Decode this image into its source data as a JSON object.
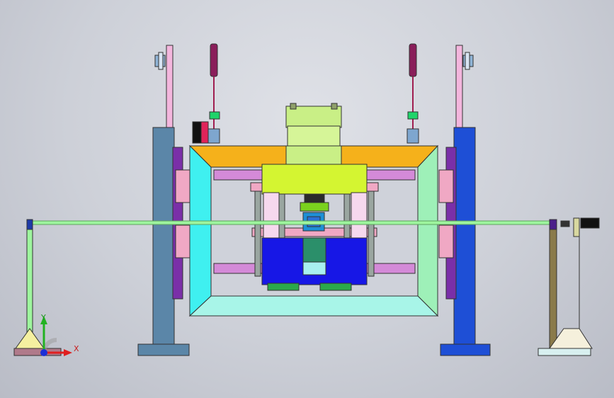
{
  "view": {
    "background_top": "#dfe1e7",
    "background_bottom": "#b9bcc6"
  },
  "triad": {
    "x_label": "X",
    "y_label": "Y",
    "x_color": "#e01f1f",
    "y_color": "#22b222",
    "z_color": "#1b2fd6"
  },
  "colors": {
    "left_post": "#5b86a8",
    "right_post": "#1e4fd6",
    "top_beam": "#f5b11b",
    "frame_left": "#3ff0f0",
    "frame_right": "#9ef0b8",
    "frame_bottom": "#a8f5e8",
    "cylinder": "#c9ef86",
    "press_plate": "#d4f531",
    "blue_block": "#1717e6",
    "green_rod": "#9ef59e",
    "rails": "#d48ad8",
    "pink_plate": "#f0a8c4"
  }
}
